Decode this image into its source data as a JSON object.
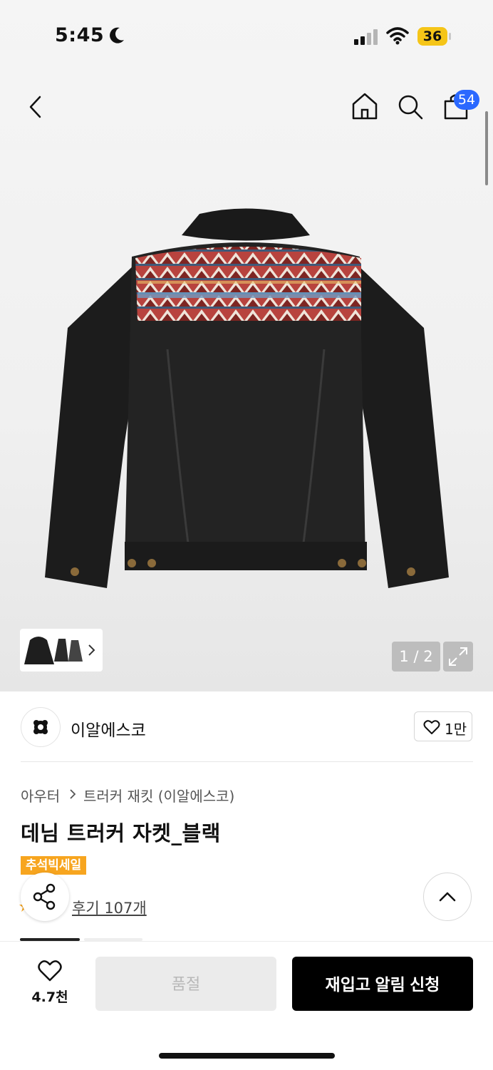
{
  "status_bar": {
    "time": "5:45",
    "battery": "36",
    "icons": [
      "moon-icon",
      "signal-icon",
      "wifi-icon",
      "battery-icon"
    ]
  },
  "nav": {
    "cart_count": "54",
    "icons": [
      "back-icon",
      "home-icon",
      "search-icon",
      "cart-icon"
    ]
  },
  "gallery": {
    "counter": "1 / 2",
    "expand_icon": "expand-icon"
  },
  "brand": {
    "name": "이알에스코",
    "likes": "1만"
  },
  "product": {
    "breadcrumb": [
      "아우터",
      "트러커 재킷 (이알에스코)"
    ],
    "title": "데님 트러커 자켓_블랙",
    "badge": "추석빅세일",
    "review_link": "후기 107개"
  },
  "bottom_bar": {
    "wish_count": "4.7천",
    "soldout_label": "품절",
    "restock_label": "재입고 알림 신청"
  },
  "colors": {
    "badge": "#f7a51f",
    "cart_badge": "#2a68ff",
    "primary_button": "#000000",
    "disabled_button": "#ebebeb"
  }
}
